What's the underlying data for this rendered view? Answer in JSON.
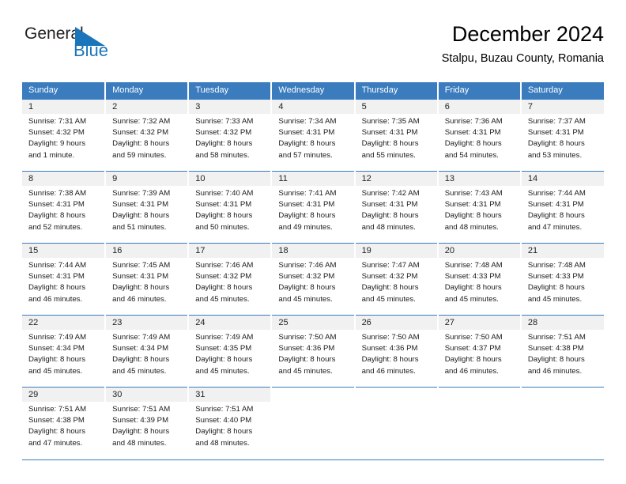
{
  "brand": {
    "name_top": "General",
    "name_bottom": "Blue",
    "accent_color": "#1b75bb",
    "text_color": "#231f20"
  },
  "header": {
    "title": "December 2024",
    "subtitle": "Stalpu, Buzau County, Romania"
  },
  "theme": {
    "header_row_bg": "#3a7cbe",
    "header_row_text": "#ffffff",
    "daynum_band_bg": "#f1f1f1",
    "grid_rule": "#3a7cbe",
    "page_bg": "#ffffff"
  },
  "calendar": {
    "weekday_headers": [
      "Sunday",
      "Monday",
      "Tuesday",
      "Wednesday",
      "Thursday",
      "Friday",
      "Saturday"
    ],
    "weeks": [
      [
        {
          "day": "1",
          "sunrise": "Sunrise: 7:31 AM",
          "sunset": "Sunset: 4:32 PM",
          "daylight_line1": "Daylight: 9 hours",
          "daylight_line2": "and 1 minute."
        },
        {
          "day": "2",
          "sunrise": "Sunrise: 7:32 AM",
          "sunset": "Sunset: 4:32 PM",
          "daylight_line1": "Daylight: 8 hours",
          "daylight_line2": "and 59 minutes."
        },
        {
          "day": "3",
          "sunrise": "Sunrise: 7:33 AM",
          "sunset": "Sunset: 4:32 PM",
          "daylight_line1": "Daylight: 8 hours",
          "daylight_line2": "and 58 minutes."
        },
        {
          "day": "4",
          "sunrise": "Sunrise: 7:34 AM",
          "sunset": "Sunset: 4:31 PM",
          "daylight_line1": "Daylight: 8 hours",
          "daylight_line2": "and 57 minutes."
        },
        {
          "day": "5",
          "sunrise": "Sunrise: 7:35 AM",
          "sunset": "Sunset: 4:31 PM",
          "daylight_line1": "Daylight: 8 hours",
          "daylight_line2": "and 55 minutes."
        },
        {
          "day": "6",
          "sunrise": "Sunrise: 7:36 AM",
          "sunset": "Sunset: 4:31 PM",
          "daylight_line1": "Daylight: 8 hours",
          "daylight_line2": "and 54 minutes."
        },
        {
          "day": "7",
          "sunrise": "Sunrise: 7:37 AM",
          "sunset": "Sunset: 4:31 PM",
          "daylight_line1": "Daylight: 8 hours",
          "daylight_line2": "and 53 minutes."
        }
      ],
      [
        {
          "day": "8",
          "sunrise": "Sunrise: 7:38 AM",
          "sunset": "Sunset: 4:31 PM",
          "daylight_line1": "Daylight: 8 hours",
          "daylight_line2": "and 52 minutes."
        },
        {
          "day": "9",
          "sunrise": "Sunrise: 7:39 AM",
          "sunset": "Sunset: 4:31 PM",
          "daylight_line1": "Daylight: 8 hours",
          "daylight_line2": "and 51 minutes."
        },
        {
          "day": "10",
          "sunrise": "Sunrise: 7:40 AM",
          "sunset": "Sunset: 4:31 PM",
          "daylight_line1": "Daylight: 8 hours",
          "daylight_line2": "and 50 minutes."
        },
        {
          "day": "11",
          "sunrise": "Sunrise: 7:41 AM",
          "sunset": "Sunset: 4:31 PM",
          "daylight_line1": "Daylight: 8 hours",
          "daylight_line2": "and 49 minutes."
        },
        {
          "day": "12",
          "sunrise": "Sunrise: 7:42 AM",
          "sunset": "Sunset: 4:31 PM",
          "daylight_line1": "Daylight: 8 hours",
          "daylight_line2": "and 48 minutes."
        },
        {
          "day": "13",
          "sunrise": "Sunrise: 7:43 AM",
          "sunset": "Sunset: 4:31 PM",
          "daylight_line1": "Daylight: 8 hours",
          "daylight_line2": "and 48 minutes."
        },
        {
          "day": "14",
          "sunrise": "Sunrise: 7:44 AM",
          "sunset": "Sunset: 4:31 PM",
          "daylight_line1": "Daylight: 8 hours",
          "daylight_line2": "and 47 minutes."
        }
      ],
      [
        {
          "day": "15",
          "sunrise": "Sunrise: 7:44 AM",
          "sunset": "Sunset: 4:31 PM",
          "daylight_line1": "Daylight: 8 hours",
          "daylight_line2": "and 46 minutes."
        },
        {
          "day": "16",
          "sunrise": "Sunrise: 7:45 AM",
          "sunset": "Sunset: 4:31 PM",
          "daylight_line1": "Daylight: 8 hours",
          "daylight_line2": "and 46 minutes."
        },
        {
          "day": "17",
          "sunrise": "Sunrise: 7:46 AM",
          "sunset": "Sunset: 4:32 PM",
          "daylight_line1": "Daylight: 8 hours",
          "daylight_line2": "and 45 minutes."
        },
        {
          "day": "18",
          "sunrise": "Sunrise: 7:46 AM",
          "sunset": "Sunset: 4:32 PM",
          "daylight_line1": "Daylight: 8 hours",
          "daylight_line2": "and 45 minutes."
        },
        {
          "day": "19",
          "sunrise": "Sunrise: 7:47 AM",
          "sunset": "Sunset: 4:32 PM",
          "daylight_line1": "Daylight: 8 hours",
          "daylight_line2": "and 45 minutes."
        },
        {
          "day": "20",
          "sunrise": "Sunrise: 7:48 AM",
          "sunset": "Sunset: 4:33 PM",
          "daylight_line1": "Daylight: 8 hours",
          "daylight_line2": "and 45 minutes."
        },
        {
          "day": "21",
          "sunrise": "Sunrise: 7:48 AM",
          "sunset": "Sunset: 4:33 PM",
          "daylight_line1": "Daylight: 8 hours",
          "daylight_line2": "and 45 minutes."
        }
      ],
      [
        {
          "day": "22",
          "sunrise": "Sunrise: 7:49 AM",
          "sunset": "Sunset: 4:34 PM",
          "daylight_line1": "Daylight: 8 hours",
          "daylight_line2": "and 45 minutes."
        },
        {
          "day": "23",
          "sunrise": "Sunrise: 7:49 AM",
          "sunset": "Sunset: 4:34 PM",
          "daylight_line1": "Daylight: 8 hours",
          "daylight_line2": "and 45 minutes."
        },
        {
          "day": "24",
          "sunrise": "Sunrise: 7:49 AM",
          "sunset": "Sunset: 4:35 PM",
          "daylight_line1": "Daylight: 8 hours",
          "daylight_line2": "and 45 minutes."
        },
        {
          "day": "25",
          "sunrise": "Sunrise: 7:50 AM",
          "sunset": "Sunset: 4:36 PM",
          "daylight_line1": "Daylight: 8 hours",
          "daylight_line2": "and 45 minutes."
        },
        {
          "day": "26",
          "sunrise": "Sunrise: 7:50 AM",
          "sunset": "Sunset: 4:36 PM",
          "daylight_line1": "Daylight: 8 hours",
          "daylight_line2": "and 46 minutes."
        },
        {
          "day": "27",
          "sunrise": "Sunrise: 7:50 AM",
          "sunset": "Sunset: 4:37 PM",
          "daylight_line1": "Daylight: 8 hours",
          "daylight_line2": "and 46 minutes."
        },
        {
          "day": "28",
          "sunrise": "Sunrise: 7:51 AM",
          "sunset": "Sunset: 4:38 PM",
          "daylight_line1": "Daylight: 8 hours",
          "daylight_line2": "and 46 minutes."
        }
      ],
      [
        {
          "day": "29",
          "sunrise": "Sunrise: 7:51 AM",
          "sunset": "Sunset: 4:38 PM",
          "daylight_line1": "Daylight: 8 hours",
          "daylight_line2": "and 47 minutes."
        },
        {
          "day": "30",
          "sunrise": "Sunrise: 7:51 AM",
          "sunset": "Sunset: 4:39 PM",
          "daylight_line1": "Daylight: 8 hours",
          "daylight_line2": "and 48 minutes."
        },
        {
          "day": "31",
          "sunrise": "Sunrise: 7:51 AM",
          "sunset": "Sunset: 4:40 PM",
          "daylight_line1": "Daylight: 8 hours",
          "daylight_line2": "and 48 minutes."
        },
        {
          "day": "",
          "sunrise": "",
          "sunset": "",
          "daylight_line1": "",
          "daylight_line2": ""
        },
        {
          "day": "",
          "sunrise": "",
          "sunset": "",
          "daylight_line1": "",
          "daylight_line2": ""
        },
        {
          "day": "",
          "sunrise": "",
          "sunset": "",
          "daylight_line1": "",
          "daylight_line2": ""
        },
        {
          "day": "",
          "sunrise": "",
          "sunset": "",
          "daylight_line1": "",
          "daylight_line2": ""
        }
      ]
    ]
  }
}
